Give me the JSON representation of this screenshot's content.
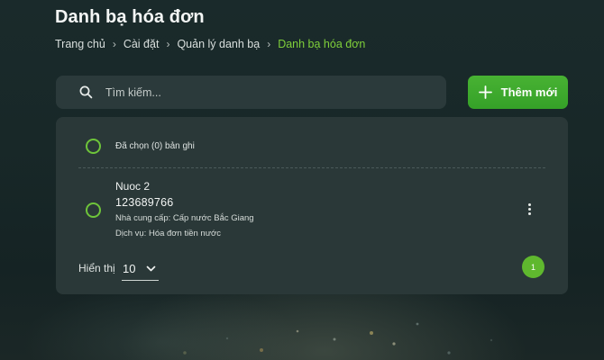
{
  "page": {
    "title": "Danh bạ hóa đơn"
  },
  "breadcrumb": {
    "items": [
      "Trang chủ",
      "Cài đặt",
      "Quản lý danh bạ",
      "Danh bạ hóa đơn"
    ],
    "separator": "›"
  },
  "search": {
    "placeholder": "Tìm kiếm...",
    "value": "",
    "icon": "search-icon"
  },
  "toolbar": {
    "add_label": "Thêm mới",
    "add_icon": "plus-icon"
  },
  "list": {
    "selected_count_text": "Đã chọn (0) bản ghi",
    "items": [
      {
        "name": "Nuoc 2",
        "account": "123689766",
        "provider": "Nhà cung cấp: Cấp nước Bắc Giang",
        "service": "Dịch vụ: Hóa đơn tiền nước",
        "menu_icon": "more-vertical-icon"
      }
    ]
  },
  "pagination": {
    "show_label": "Hiển thị",
    "page_size": "10",
    "current_page": "1"
  },
  "colors": {
    "accent": "#7fcf3a",
    "button": "#3fa92e",
    "panel": "#2a3838",
    "search_bg": "#2b3a3b"
  }
}
